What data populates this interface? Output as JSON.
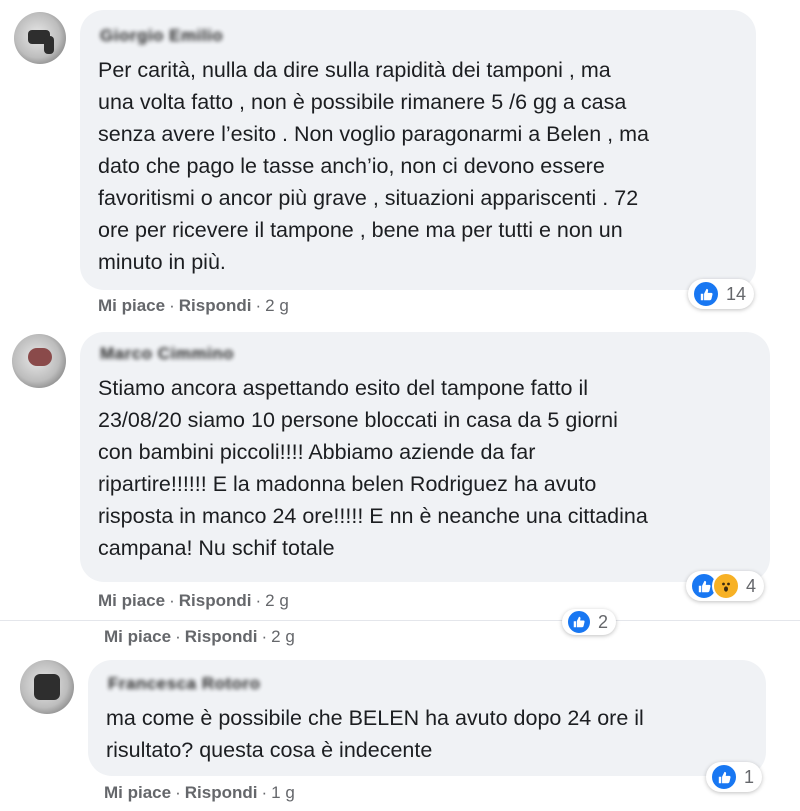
{
  "comments": [
    {
      "author": "Giorgio Emilio",
      "text": "Per carità, nulla da dire sulla rapidità dei tamponi , ma\nuna volta fatto , non è possibile rimanere 5 /6 gg a casa\nsenza avere l’esito . Non voglio paragonarmi a Belen , ma\ndato che pago le tasse anch’io, non ci devono essere\nfavoritismi o ancor più grave , situazioni appariscenti . 72\nore per ricevere il tampone , bene ma per tutti e non un\nminuto in più.",
      "like": "Mi piace",
      "reply": "Rispondi",
      "time": "2 g",
      "reaction_count": "14",
      "reaction_icons": [
        "like-icon"
      ]
    },
    {
      "author": "Marco Cimmino",
      "text": "Stiamo ancora aspettando esito del tampone fatto il\n23/08/20 siamo 10 persone bloccati in casa da 5 giorni\ncon bambini piccoli!!!! Abbiamo aziende da far\nripartire!!!!!! E la madonna belen Rodriguez ha avuto\nrisposta in manco 24 ore!!!!! E nn è neanche una cittadina\ncampana! Nu schif totale",
      "like": "Mi piace",
      "reply": "Rispondi",
      "time": "2 g",
      "reaction_count": "4",
      "reaction_icons": [
        "like-icon",
        "wow-icon"
      ]
    },
    {
      "hidden_comment": true,
      "like": "Mi piace",
      "reply": "Rispondi",
      "time": "2 g",
      "reaction_count": "2",
      "reaction_icons": [
        "like-icon"
      ]
    },
    {
      "author": "Francesca Rotoro",
      "text": "ma come è possibile che BELEN ha avuto dopo 24 ore il\nrisultato? questa cosa è indecente",
      "like": "Mi piace",
      "reply": "Rispondi",
      "time": "1 g",
      "reaction_count": "1",
      "reaction_icons": [
        "like-icon"
      ]
    }
  ],
  "separator": "·",
  "colors": {
    "like": "#1877f2",
    "wow": "#f7b125",
    "bubble": "#f0f2f5",
    "meta": "#65676b"
  }
}
